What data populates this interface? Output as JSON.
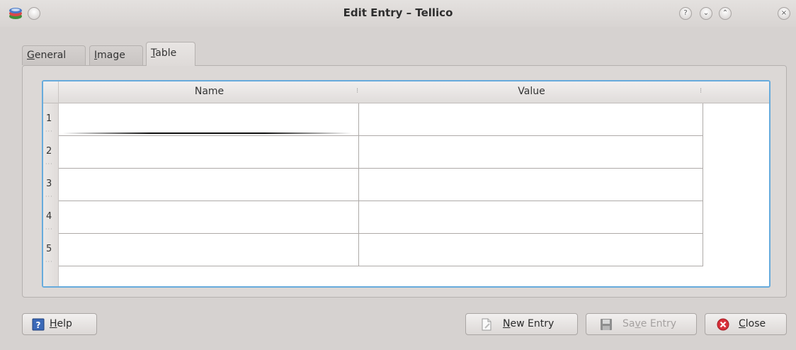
{
  "window": {
    "title": "Edit Entry – Tellico"
  },
  "titlebar": {
    "help_glyph": "?",
    "min_glyph": "⌄",
    "max_glyph": "⌃",
    "close_glyph": "×"
  },
  "tabs": [
    {
      "label": "General",
      "mnemonic": "G",
      "rest": "eneral"
    },
    {
      "label": "Image",
      "mnemonic": "I",
      "rest": "mage"
    },
    {
      "label": "Table",
      "mnemonic": "T",
      "rest": "able",
      "active": true
    }
  ],
  "table": {
    "columns": [
      "Name",
      "Value"
    ],
    "rows": [
      {
        "number": "1",
        "name": "",
        "value": ""
      },
      {
        "number": "2",
        "name": "",
        "value": ""
      },
      {
        "number": "3",
        "name": "",
        "value": ""
      },
      {
        "number": "4",
        "name": "",
        "value": ""
      },
      {
        "number": "5",
        "name": "",
        "value": ""
      }
    ],
    "row_dots": "···"
  },
  "buttons": {
    "help": {
      "mnemonic": "H",
      "rest": "elp"
    },
    "new_entry": {
      "mnemonic": "N",
      "rest": "ew Entry"
    },
    "save_entry": {
      "pre": "Sa",
      "mnemonic": "v",
      "rest": "e Entry",
      "enabled": false
    },
    "close": {
      "mnemonic": "C",
      "rest": "lose"
    }
  },
  "colors": {
    "table_focus_border": "#67abdc",
    "close_icon": "#d8313b"
  }
}
